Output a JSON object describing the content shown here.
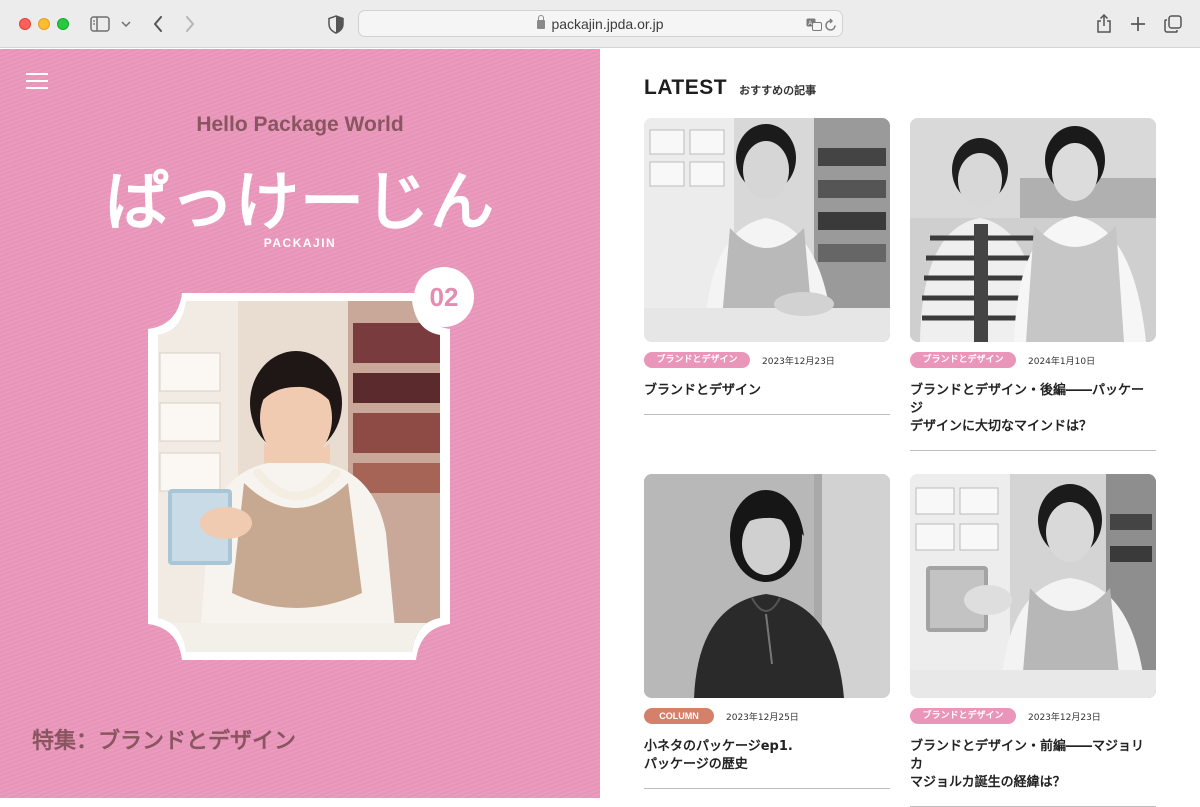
{
  "browser": {
    "url": "packajin.jpda.or.jp"
  },
  "hero": {
    "tagline": "Hello Package World",
    "title": "ぱっけーじん",
    "subtitle": "PACKAJIN",
    "issue_number": "02",
    "feature": "特集：ブランドとデザイン",
    "background_color": "#ea96bb"
  },
  "latest": {
    "heading": "LATEST",
    "subheading": "おすすめの記事",
    "articles": [
      {
        "tag": "ブランドとデザイン",
        "date": "2023年12月23日",
        "title": "ブランドとデザイン",
        "tag_color": "#ea96bb"
      },
      {
        "tag": "ブランドとデザイン",
        "date": "2024年1月10日",
        "title_line1": "ブランドとデザイン・後編――パッケージ",
        "title_line2": "デザインに大切なマインドは？",
        "tag_color": "#ea96bb"
      },
      {
        "tag": "COLUMN",
        "date": "2023年12月25日",
        "title_line1": "小ネタのパッケージep1.",
        "title_line2": "パッケージの歴史",
        "tag_color": "#d4806a"
      },
      {
        "tag": "ブランドとデザイン",
        "date": "2023年12月23日",
        "title_line1": "ブランドとデザイン・前編――マジョリカ",
        "title_line2": "マジョルカ誕生の経緯は？",
        "tag_color": "#ea96bb"
      }
    ]
  }
}
